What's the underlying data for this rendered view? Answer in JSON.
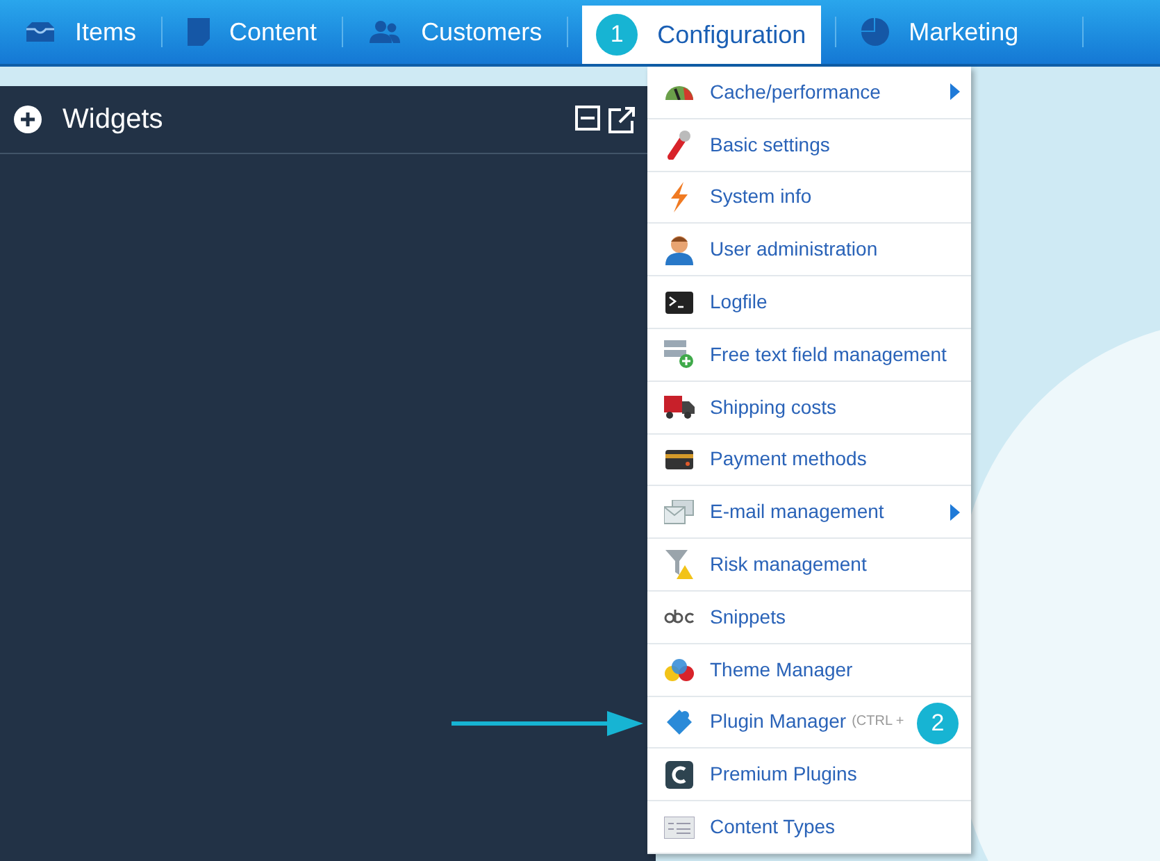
{
  "nav": {
    "tabs": [
      {
        "label": "Items",
        "selected": false
      },
      {
        "label": "Content",
        "selected": false
      },
      {
        "label": "Customers",
        "selected": false
      },
      {
        "label": "Configuration",
        "selected": true,
        "callout": "1"
      },
      {
        "label": "Marketing",
        "selected": false
      }
    ]
  },
  "widgets_panel": {
    "title": "Widgets"
  },
  "config_menu": {
    "items": [
      {
        "label": "Cache/performance",
        "has_submenu": true
      },
      {
        "label": "Basic settings",
        "has_submenu": false
      },
      {
        "label": "System info",
        "has_submenu": false
      },
      {
        "label": "User administration",
        "has_submenu": false
      },
      {
        "label": "Logfile",
        "has_submenu": false
      },
      {
        "label": "Free text field management",
        "has_submenu": false
      },
      {
        "label": "Shipping costs",
        "has_submenu": false
      },
      {
        "label": "Payment methods",
        "has_submenu": false
      },
      {
        "label": "E-mail management",
        "has_submenu": true
      },
      {
        "label": "Risk management",
        "has_submenu": false
      },
      {
        "label": "Snippets",
        "has_submenu": false
      },
      {
        "label": "Theme Manager",
        "has_submenu": false
      },
      {
        "label": "Plugin Manager",
        "has_submenu": false,
        "shortcut": "(CTRL +",
        "callout": "2"
      },
      {
        "label": "Premium Plugins",
        "has_submenu": false
      },
      {
        "label": "Content Types",
        "has_submenu": false
      }
    ]
  }
}
